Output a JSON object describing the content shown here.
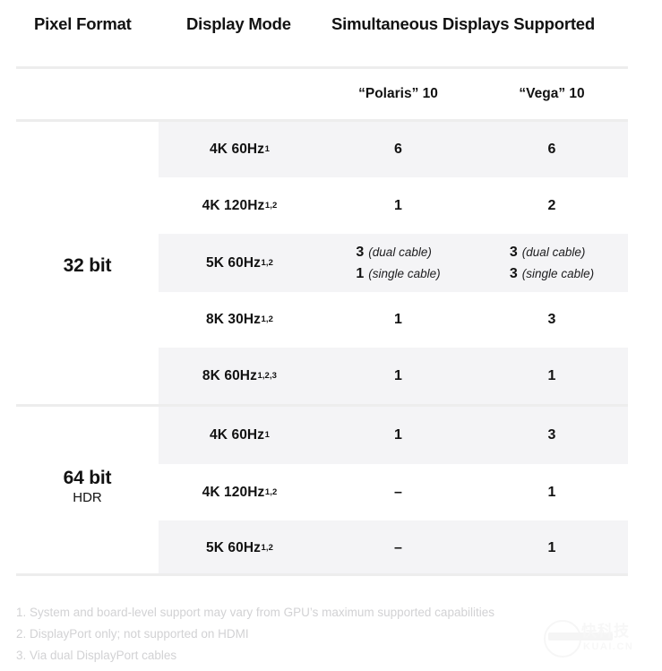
{
  "table": {
    "headers": {
      "pixel_format": "Pixel Format",
      "display_mode": "Display Mode",
      "simultaneous": "Simultaneous Displays Supported"
    },
    "gpu_columns": [
      {
        "label": "“Polaris” 10"
      },
      {
        "label": "“Vega”  10"
      }
    ],
    "groups": [
      {
        "id": "32bit",
        "label_main": "32 bit",
        "label_sub": "",
        "rows": [
          {
            "mode": "4K  60Hz",
            "mode_sup": "1",
            "polaris": {
              "type": "single",
              "value": "6"
            },
            "vega": {
              "type": "single",
              "value": "6"
            }
          },
          {
            "mode": "4K  120Hz",
            "mode_sup": "1,2",
            "polaris": {
              "type": "single",
              "value": "1"
            },
            "vega": {
              "type": "single",
              "value": "2"
            }
          },
          {
            "mode": "5K  60Hz",
            "mode_sup": "1,2",
            "polaris": {
              "type": "multi",
              "lines": [
                {
                  "n": "3",
                  "cap": "(dual cable)"
                },
                {
                  "n": "1",
                  "cap": "(single cable)"
                }
              ]
            },
            "vega": {
              "type": "multi",
              "lines": [
                {
                  "n": "3",
                  "cap": "(dual cable)"
                },
                {
                  "n": "3",
                  "cap": "(single cable)"
                }
              ]
            }
          },
          {
            "mode": "8K  30Hz",
            "mode_sup": "1,2",
            "polaris": {
              "type": "single",
              "value": "1"
            },
            "vega": {
              "type": "single",
              "value": "3"
            }
          },
          {
            "mode": "8K  60Hz",
            "mode_sup": "1,2,3",
            "polaris": {
              "type": "single",
              "value": "1"
            },
            "vega": {
              "type": "single",
              "value": "1"
            }
          }
        ]
      },
      {
        "id": "64bit",
        "label_main": "64 bit",
        "label_sub": "HDR",
        "rows": [
          {
            "mode": "4K  60Hz",
            "mode_sup": "1",
            "polaris": {
              "type": "single",
              "value": "1"
            },
            "vega": {
              "type": "single",
              "value": "3"
            }
          },
          {
            "mode": "4K  120Hz",
            "mode_sup": "1,2",
            "polaris": {
              "type": "single",
              "value": "–"
            },
            "vega": {
              "type": "single",
              "value": "1"
            }
          },
          {
            "mode": "5K  60Hz",
            "mode_sup": "1,2",
            "polaris": {
              "type": "single",
              "value": "–"
            },
            "vega": {
              "type": "single",
              "value": "1"
            }
          }
        ]
      }
    ]
  },
  "footnotes": [
    "1.  System and board-level support may vary from GPU’s maximum supported capabilities",
    "2. DisplayPort only; not supported on HDMI",
    "3. Via dual DisplayPort cables"
  ],
  "watermark": {
    "text": "快科技",
    "sub": "KUAI.CN"
  },
  "colors": {
    "band": "#f4f4f6",
    "rule": "#ededed",
    "text": "#121212",
    "footnote": "#d2d2d4"
  }
}
